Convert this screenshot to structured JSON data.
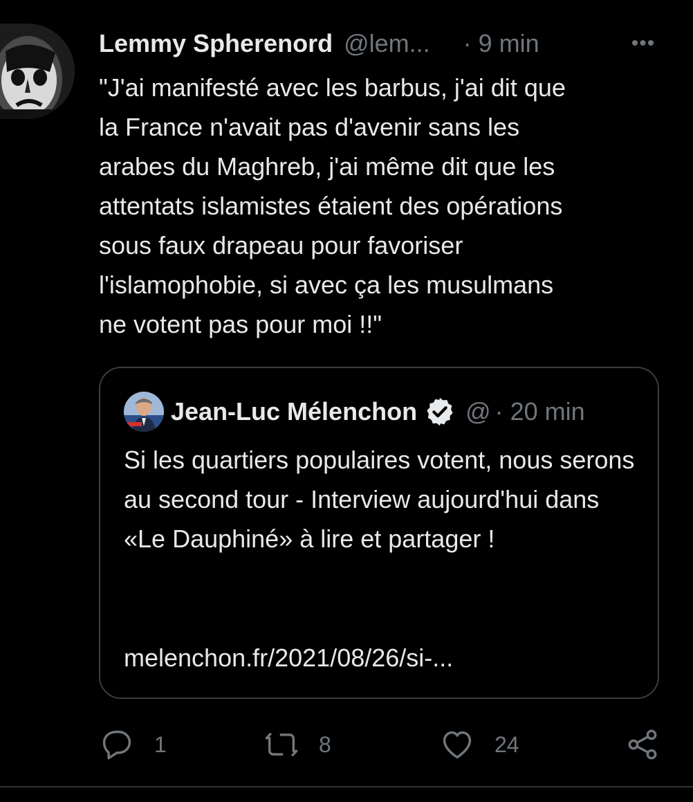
{
  "tweet": {
    "author": {
      "name": "Lemmy Spherenord",
      "handle": "@lem...",
      "time": "· 9 min"
    },
    "more_label": "•••",
    "text": "\"J'ai manifesté avec les barbus, j'ai dit que\nla France n'avait pas d'avenir sans les\narabes du Maghreb, j'ai même dit que les\nattentats islamistes étaient des opérations\nsous faux drapeau pour favoriser\nl'islamophobie, si avec ça les musulmans\nne votent pas pour moi !!\"",
    "quote": {
      "name": "Jean-Luc Mélenchon",
      "handle": "@",
      "time": "· 20 min",
      "text": "Si les quartiers populaires votent, nous serons au second tour - Interview aujourd'hui dans «Le Dauphiné» à lire et partager !",
      "link": "melenchon.fr/2021/08/26/si-..."
    },
    "actions": {
      "reply_count": "1",
      "retweet_count": "8",
      "like_count": "24"
    }
  },
  "icons": {
    "more": "more-horizontal-icon",
    "verified": "verified-badge-icon",
    "reply": "reply-icon",
    "retweet": "retweet-icon",
    "like": "heart-icon",
    "share": "share-icon"
  },
  "colors": {
    "background": "#000000",
    "text_primary": "#e7e9ea",
    "text_secondary": "#71767b",
    "border": "#3a3d41"
  }
}
